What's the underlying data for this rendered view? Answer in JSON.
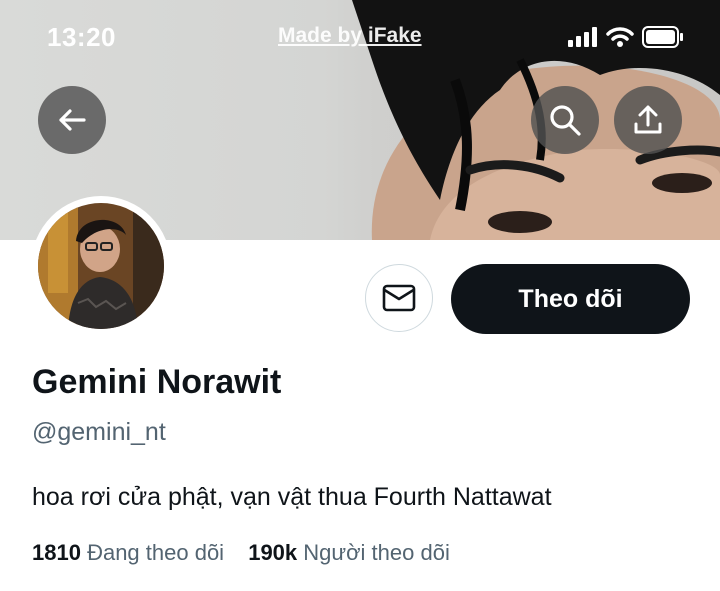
{
  "status_bar": {
    "time": "13:20",
    "watermark": "Made by iFake"
  },
  "header": {
    "back_icon": "arrow-left-icon",
    "search_icon": "search-icon",
    "share_icon": "share-upload-icon"
  },
  "actions": {
    "message_icon": "envelope-icon",
    "follow_label": "Theo dõi"
  },
  "profile": {
    "name": "Gemini Norawit",
    "handle": "@gemini_nt",
    "bio": "hoa rơi cửa phật, vạn vật thua Fourth Nattawat"
  },
  "stats": {
    "following_count": "1810",
    "following_label": "Đang theo dõi",
    "followers_count": "190k",
    "followers_label": "Người theo dõi"
  },
  "colors": {
    "primary_text": "#0f1419",
    "secondary_text": "#536471",
    "follow_button": "#0f1419"
  }
}
